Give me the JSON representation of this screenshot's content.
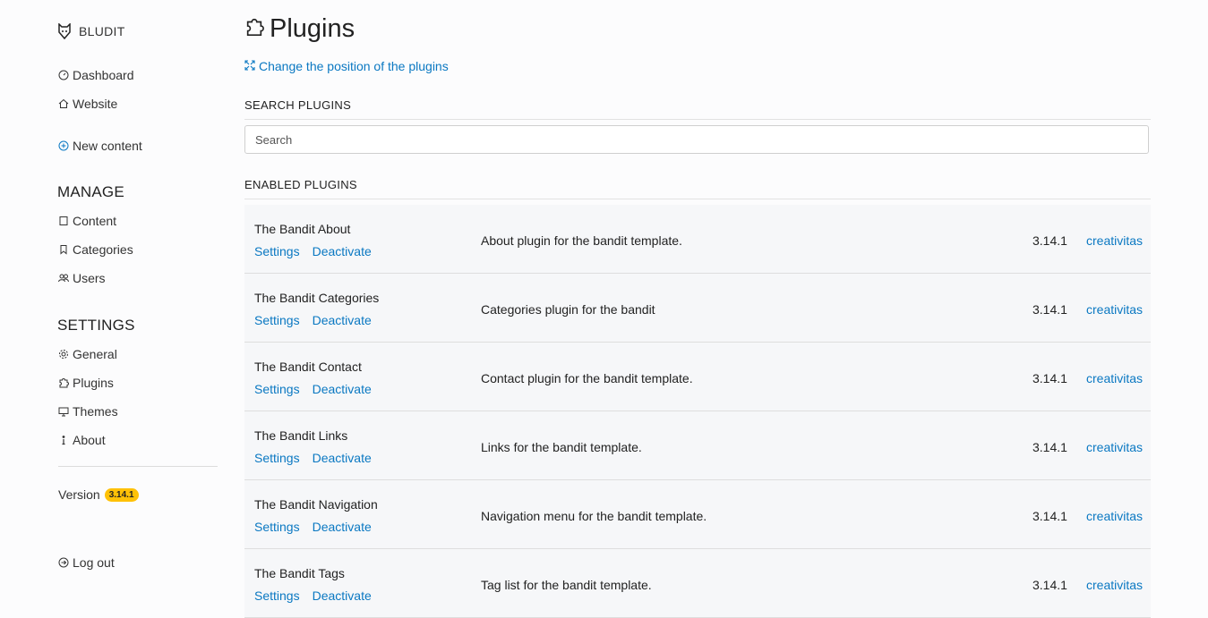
{
  "brand": {
    "name": "BLUDIT",
    "icon": "bludit-logo-icon"
  },
  "sidebar": {
    "top_items": [
      {
        "label": "Dashboard",
        "icon": "dashboard-icon"
      },
      {
        "label": "Website",
        "icon": "home-icon"
      }
    ],
    "new_content": {
      "label": "New content",
      "icon": "plus-circle-icon"
    },
    "manage_title": "MANAGE",
    "manage_items": [
      {
        "label": "Content",
        "icon": "archive-icon"
      },
      {
        "label": "Categories",
        "icon": "bookmark-icon"
      },
      {
        "label": "Users",
        "icon": "people-icon"
      }
    ],
    "settings_title": "SETTINGS",
    "settings_items": [
      {
        "label": "General",
        "icon": "gear-icon"
      },
      {
        "label": "Plugins",
        "icon": "puzzle-icon"
      },
      {
        "label": "Themes",
        "icon": "monitor-icon"
      },
      {
        "label": "About",
        "icon": "info-icon"
      }
    ],
    "version_label": "Version",
    "version_badge": "3.14.1",
    "logout": {
      "label": "Log out",
      "icon": "logout-icon"
    }
  },
  "main": {
    "title": "Plugins",
    "title_icon": "puzzle-icon",
    "position_link": "Change the position of the plugins",
    "search_heading": "SEARCH PLUGINS",
    "search_placeholder": "Search",
    "enabled_heading": "ENABLED PLUGINS",
    "settings_label": "Settings",
    "deactivate_label": "Deactivate",
    "plugins": [
      {
        "name": "The Bandit About",
        "description": "About plugin for the bandit template.",
        "version": "3.14.1",
        "author": "creativitas"
      },
      {
        "name": "The Bandit Categories",
        "description": "Categories plugin for the bandit",
        "version": "3.14.1",
        "author": "creativitas"
      },
      {
        "name": "The Bandit Contact",
        "description": "Contact plugin for the bandit template.",
        "version": "3.14.1",
        "author": "creativitas"
      },
      {
        "name": "The Bandit Links",
        "description": "Links for the bandit template.",
        "version": "3.14.1",
        "author": "creativitas"
      },
      {
        "name": "The Bandit Navigation",
        "description": "Navigation menu for the bandit template.",
        "version": "3.14.1",
        "author": "creativitas"
      },
      {
        "name": "The Bandit Tags",
        "description": "Tag list for the bandit template.",
        "version": "3.14.1",
        "author": "creativitas"
      }
    ]
  },
  "colors": {
    "link": "#0a78c2",
    "badge": "#ffc107",
    "row_bg": "#f6f7f9"
  }
}
